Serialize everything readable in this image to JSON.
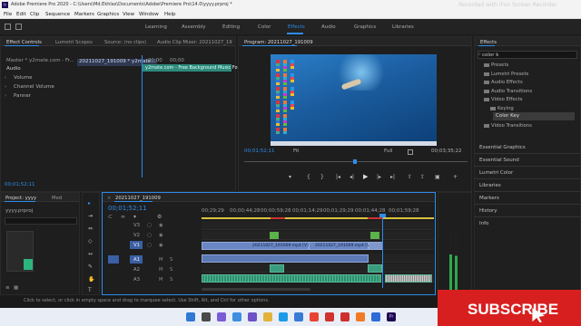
{
  "window": {
    "title": "Adobe Premiere Pro 2020 - C:\\Users\\Md.Ekhlas\\Documents\\Adobe\\Premiere Pro\\14.0\\yyyy.prproj *",
    "watermark": "Recorded with iFun Screen Recorder"
  },
  "menu": [
    "File",
    "Edit",
    "Clip",
    "Sequence",
    "Markers",
    "Graphics",
    "View",
    "Window",
    "Help"
  ],
  "workspaces": [
    "Learning",
    "Assembly",
    "Editing",
    "Color",
    "Effects",
    "Audio",
    "Graphics",
    "Libraries"
  ],
  "workspace_active": "Effects",
  "effect_controls": {
    "tabs": [
      "Effect Controls",
      "Lumetri Scopes",
      "Source: (no clips)",
      "Audio Clip Mixer: 20211027_19"
    ],
    "master": "Master * y2mate.com - Fr...",
    "sequence_clip": "20211027_191009 * y2mate...",
    "timecode_small": ";00;00",
    "ruler_start": "00;00",
    "clip_label": "y2mate.com - Free Background Music Fo",
    "section": "Audio",
    "params": [
      "Volume",
      "Channel Volume",
      "Panner"
    ],
    "timecode": "00;01;52;11"
  },
  "program": {
    "tab": "Program: 20211027_191009",
    "timecode": "00;01;52;11",
    "fit": "Fit",
    "quality": "Full",
    "duration": "00;03;35;22"
  },
  "project": {
    "tabs": [
      "Project: yyyy",
      "Med"
    ],
    "file": "yyyy.prproj"
  },
  "timeline": {
    "tab": "20211027_191009",
    "timecode": "00;01;52;11",
    "ruler": [
      "00;29;29",
      "00;00;44;28",
      "00;00;59;28",
      "00;01;14;29",
      "00;01;29;29",
      "00;01;44;28",
      "00;01;59;28"
    ],
    "tracks_video": [
      "V3",
      "V2",
      "V1"
    ],
    "tracks_audio": [
      "A1",
      "A2",
      "A3"
    ],
    "clip1": "20211027_191009.mp4 [V]",
    "clip2": "20211027_191009.mp4 [V]"
  },
  "effects": {
    "tab": "Effects",
    "search": "color k",
    "items": [
      "Presets",
      "Lumetri Presets",
      "Audio Effects",
      "Audio Transitions",
      "Video Effects",
      "Keying",
      "Color Key",
      "Video Transitions"
    ],
    "panels": [
      "Essential Graphics",
      "Essential Sound",
      "Lumetri Color",
      "Libraries",
      "Markers",
      "History",
      "Info"
    ]
  },
  "status": "Click to select, or click in empty space and drag to marquee select. Use Shift, Alt, and Ctrl for other options.",
  "subscribe": "SUBSCRIBE",
  "colors": {
    "accent": "#2d8ceb",
    "video_clip": "#6a86c4",
    "audio_clip": "#3a9c7e",
    "subscribe": "#e02020"
  }
}
